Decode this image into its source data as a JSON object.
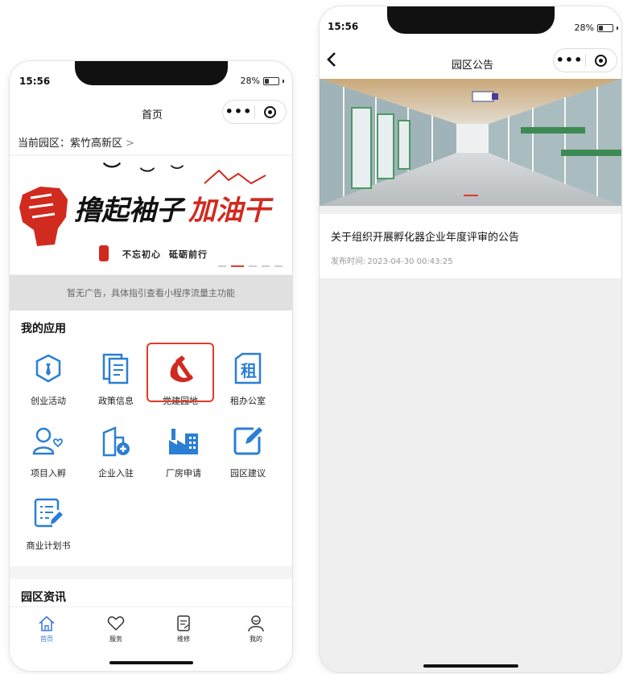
{
  "left_phone": {
    "status": {
      "time": "15:56",
      "battery": "28%",
      "battery_level": 0.28
    },
    "nav": {
      "title": "首页"
    },
    "park": {
      "label": "当前园区：紫竹高新区",
      "chevron": ">"
    },
    "banner": {
      "slogan_black": "撸起袖子",
      "slogan_red": "加油干",
      "motto_1": "不忘初心",
      "motto_2": "砥砺前行"
    },
    "ad": {
      "text": "暂无广告，具体指引查看小程序流量主功能"
    },
    "apps": {
      "title": "我的应用",
      "items": [
        {
          "label": "创业活动",
          "icon": "shield-tie-icon"
        },
        {
          "label": "政策信息",
          "icon": "document-stack-icon"
        },
        {
          "label": "党建园地",
          "icon": "hammer-sickle-icon",
          "highlighted": true
        },
        {
          "label": "租办公室",
          "icon": "rent-building-icon",
          "glyph": "租"
        },
        {
          "label": "项目入孵",
          "icon": "person-heart-icon"
        },
        {
          "label": "企业入驻",
          "icon": "building-plus-icon"
        },
        {
          "label": "厂房申请",
          "icon": "factory-icon"
        },
        {
          "label": "园区建议",
          "icon": "edit-square-icon"
        },
        {
          "label": "商业计划书",
          "icon": "checklist-pen-icon"
        }
      ]
    },
    "news": {
      "title": "园区资讯"
    },
    "tabbar": [
      {
        "label": "首页",
        "icon": "home-icon",
        "active": true
      },
      {
        "label": "服务",
        "icon": "heart-icon"
      },
      {
        "label": "维修",
        "icon": "clipboard-icon"
      },
      {
        "label": "我的",
        "icon": "user-icon"
      }
    ]
  },
  "right_phone": {
    "status": {
      "time": "15:56",
      "battery": "28%",
      "battery_level": 0.28
    },
    "nav": {
      "title": "园区公告",
      "back_icon": "back-chevron-icon"
    },
    "notice": {
      "title": "关于组织开展孵化器企业年度评审的公告",
      "time_label": "发布时间:",
      "time_value": "2023-04-30 00:43:25"
    }
  },
  "colors": {
    "accent": "#2a7fd4",
    "party_red": "#d12a1f",
    "tab_active": "#3c78d8"
  }
}
